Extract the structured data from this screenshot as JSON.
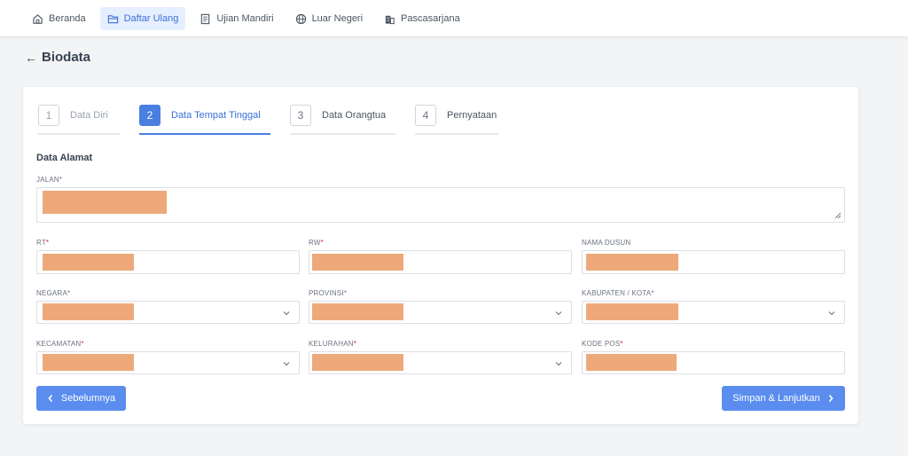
{
  "nav": {
    "items": [
      {
        "label": "Beranda",
        "icon": "home-icon"
      },
      {
        "label": "Daftar Ulang",
        "icon": "folder-icon",
        "active": true
      },
      {
        "label": "Ujian Mandiri",
        "icon": "document-icon"
      },
      {
        "label": "Luar Negeri",
        "icon": "globe-icon"
      },
      {
        "label": "Pascasarjana",
        "icon": "building-icon"
      }
    ]
  },
  "page": {
    "back_icon": "←",
    "title": "Biodata"
  },
  "steps": [
    {
      "num": "1",
      "label": "Data Diri"
    },
    {
      "num": "2",
      "label": "Data Tempat Tinggal"
    },
    {
      "num": "3",
      "label": "Data Orangtua"
    },
    {
      "num": "4",
      "label": "Pernyataan"
    }
  ],
  "form": {
    "section_title": "Data Alamat",
    "labels": {
      "jalan": "JALAN",
      "rt": "RT",
      "rw": "RW",
      "nama_dusun": "NAMA DUSUN",
      "negara": "NEGARA",
      "provinsi": "PROVINSI",
      "kabupaten": "KABUPATEN / KOTA",
      "kecamatan": "KECAMATAN",
      "kelurahan": "KELURAHAN",
      "kode_pos": "KODE POS"
    },
    "required_mark": "*"
  },
  "buttons": {
    "prev": "Sebelumnya",
    "next": "Simpan & Lanjutkan"
  },
  "colors": {
    "accent": "#4a7fe0",
    "redaction": "#eea97a"
  }
}
